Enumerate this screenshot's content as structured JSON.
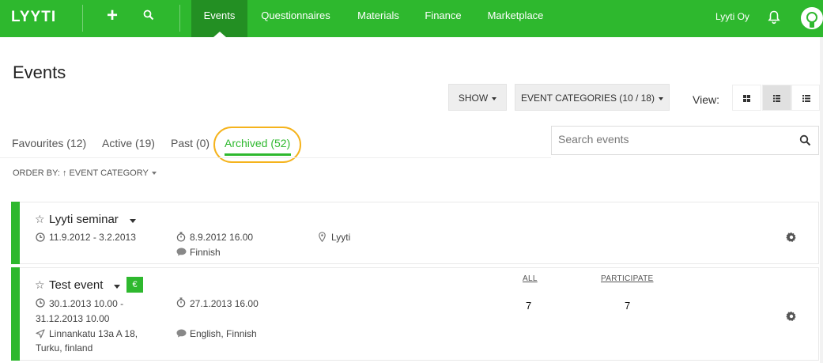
{
  "app": {
    "logo": "LYYTI",
    "org_name": "Lyyti Oy"
  },
  "nav": {
    "plus_label": "+",
    "tabs": [
      {
        "label": "Events",
        "active": true
      },
      {
        "label": "Questionnaires",
        "active": false
      },
      {
        "label": "Materials",
        "active": false
      },
      {
        "label": "Finance",
        "active": false
      },
      {
        "label": "Marketplace",
        "active": false
      }
    ]
  },
  "page": {
    "title": "Events"
  },
  "toolbar": {
    "show_label": "SHOW",
    "categories_label": "EVENT CATEGORIES (10 / 18)",
    "view_label": "View:",
    "view_modes": [
      "grid-view-icon",
      "list-view-icon",
      "compact-view-icon"
    ],
    "selected_view": "list-view-icon"
  },
  "tabs": [
    {
      "label": "Favourites (12)",
      "active": false
    },
    {
      "label": "Active (19)",
      "active": false
    },
    {
      "label": "Past (0)",
      "active": false
    },
    {
      "label": "Archived (52)",
      "active": true
    }
  ],
  "search": {
    "placeholder": "Search events",
    "value": ""
  },
  "order_by": {
    "label": "ORDER BY:",
    "value": "EVENT CATEGORY"
  },
  "events": [
    {
      "title": "Lyyti seminar",
      "dates": "11.9.2012 - 3.2.2013",
      "deadline": "8.9.2012 16.00",
      "language": "Finnish",
      "location": "Lyyti",
      "paid": false
    },
    {
      "title": "Test event",
      "dates_line1": "30.1.2013 10.00 -",
      "dates_line2": "31.12.2013 10.00",
      "deadline": "27.1.2013 16.00",
      "language": "English, Finnish",
      "location_line1": "Linnankatu 13a A 18,",
      "location_line2": "Turku, finland",
      "paid": true,
      "euro_label": "€",
      "stats": {
        "all_label": "ALL",
        "all_value": "7",
        "participate_label": "PARTICIPATE",
        "participate_value": "7"
      }
    }
  ],
  "colors": {
    "brand": "#2eb82e",
    "brand_dark": "#238f23",
    "highlight": "#f5b31c"
  }
}
